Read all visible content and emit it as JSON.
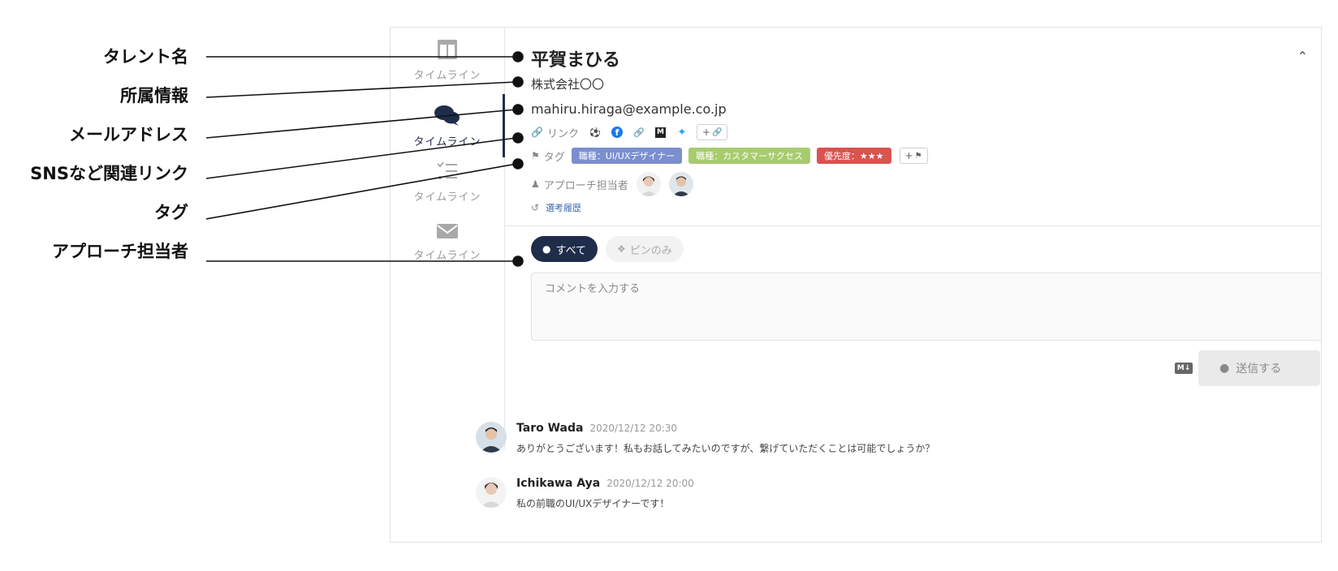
{
  "annotations": [
    {
      "label": "タレント名"
    },
    {
      "label": "所属情報"
    },
    {
      "label": "メールアドレス"
    },
    {
      "label": "SNSなど関連リンク"
    },
    {
      "label": "タグ"
    },
    {
      "label": "アプローチ担当者"
    }
  ],
  "sidebar": {
    "items": [
      {
        "label": "タイムライン",
        "icon": "columns-icon"
      },
      {
        "label": "タイムライン",
        "icon": "chat-icon",
        "active": true
      },
      {
        "label": "タイムライン",
        "icon": "checklist-icon"
      },
      {
        "label": "タイムライン",
        "icon": "mail-icon"
      }
    ]
  },
  "profile": {
    "name": "平賀まひる",
    "company": "株式会社〇〇",
    "email": "mahiru.hiraga@example.co.jp",
    "links_label": "リンク",
    "link_add": "+",
    "sns": [
      "dribbble-icon",
      "facebook-icon",
      "link-icon",
      "medium-icon",
      "twitter-icon"
    ],
    "tags_label": "タグ",
    "tag_add": "+",
    "tags": [
      {
        "label": "職種：UI/UXデザイナー",
        "color": "#7b8fce"
      },
      {
        "label": "職種：カスタマーサクセス",
        "color": "#a6cc6e"
      },
      {
        "label": "優先度：★★★",
        "color": "#d9534f"
      }
    ],
    "approach_label": "アプローチ担当者",
    "history_label": "選考履歴"
  },
  "filters": {
    "all": "すべて",
    "pin": "ピンのみ"
  },
  "comment": {
    "placeholder": "コメントを入力する",
    "markdown_badge": "M↓",
    "send": "送信する"
  },
  "messages": [
    {
      "author": "Taro Wada",
      "time": "2020/12/12 20:30",
      "text": "ありがとうございます！私もお話してみたいのですが、繋げていただくことは可能でしょうか？"
    },
    {
      "author": "Ichikawa Aya",
      "time": "2020/12/12 20:00",
      "text": "私の前職のUI/UXデザイナーです！"
    }
  ],
  "colors": {
    "accent": "#1f2d4a",
    "link": "#3a68b5"
  }
}
